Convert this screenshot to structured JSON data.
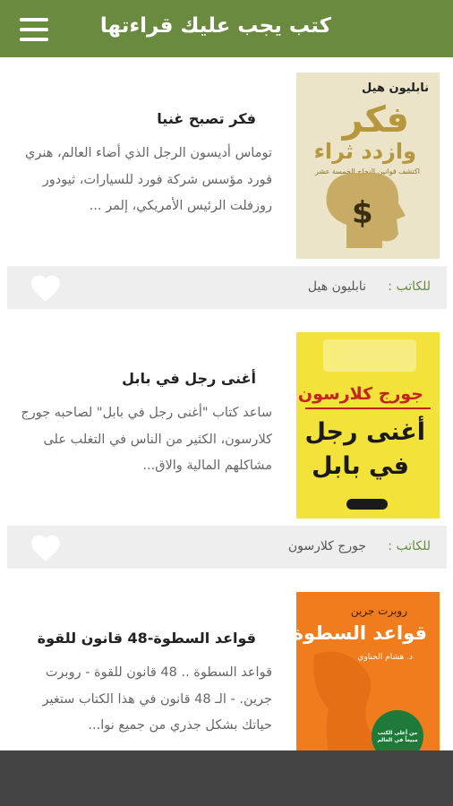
{
  "header": {
    "title": "كتب يجب عليك قراءتها",
    "menu_icon": "hamburger-menu-icon",
    "background_color": "#6a8b3f"
  },
  "books": [
    {
      "title": "فكر تصبح غنيا",
      "description": "توماس أديسون الرجل الذي أضاء العالم، هنري فورد مؤسس شركة فورد للسيارات، ثيودور روزفلت الرئيس الأمريكي، إلمر ...",
      "author_prefix": "للكاتب :",
      "author": "نابليون هيل",
      "cover": {
        "author": "نابليون هيل",
        "line1": "فكر",
        "line2": "وازدد ثراء",
        "subtitle": "اكتشف قوانين النجاح الخمسة عشر",
        "background_color": "#ece4c8"
      }
    },
    {
      "title": "أغنى رجل في بابل",
      "description": "ساعد كتاب \"أغنى رجل في بابل\" لصاحبه جورج كلارسون، الكثير من الناس في التغلب على مشاكلهم المالية والاق...",
      "author_prefix": "للكاتب :",
      "author": "جورج كلارسون",
      "cover": {
        "author": "جورج كلارسون",
        "line1": "أغنى رجل",
        "line2": "في بابل",
        "background_color": "#f3e23a"
      }
    },
    {
      "title": "قواعد السطوة-48 قانون للقوة",
      "description": "قواعد السطوة .. 48 قانون للقوة - روبرت جرين. - الـ 48 قانون في هذا الكتاب ستغير حياتك بشكل جذري من جميع نوا...",
      "cover": {
        "author": "روبرت جرين",
        "line1": "قواعد السطوة",
        "translator": "د. هشام الحناوي",
        "badge": "من أعلى الكتب مبيعاً في العالم",
        "background_color": "#f07c1e"
      }
    }
  ],
  "favorite_icon": "heart-icon",
  "accent_color": "#6a8b3f"
}
